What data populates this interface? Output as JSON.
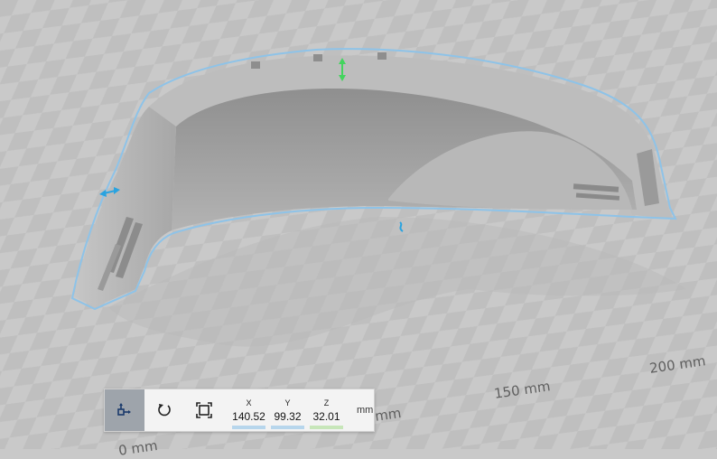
{
  "viewport": {
    "floor_labels": [
      "200 mm",
      "150 mm",
      "mm",
      "0 mm"
    ],
    "colors": {
      "floor": "#c9c9c9",
      "checker_dark": "#bcbcbc",
      "model": "#a8a8a8",
      "outline": "#8ec3e8",
      "move_handle_x": "#29a3e0",
      "move_handle_y": "#43d45e",
      "move_handle_z": "#29a3e0"
    }
  },
  "toolbar": {
    "buttons": [
      {
        "name": "move-tool",
        "icon": "move-icon",
        "active": true
      },
      {
        "name": "rotate-tool",
        "icon": "rotate-icon",
        "active": false
      },
      {
        "name": "scale-tool",
        "icon": "scale-icon",
        "active": false
      }
    ],
    "dimensions": {
      "x": {
        "label": "X",
        "value": "140.52",
        "color": "#b7d6ec"
      },
      "y": {
        "label": "Y",
        "value": "99.32",
        "color": "#b7d6ec"
      },
      "z": {
        "label": "Z",
        "value": "32.01",
        "color": "#c7e6b9"
      }
    },
    "unit": "mm"
  }
}
